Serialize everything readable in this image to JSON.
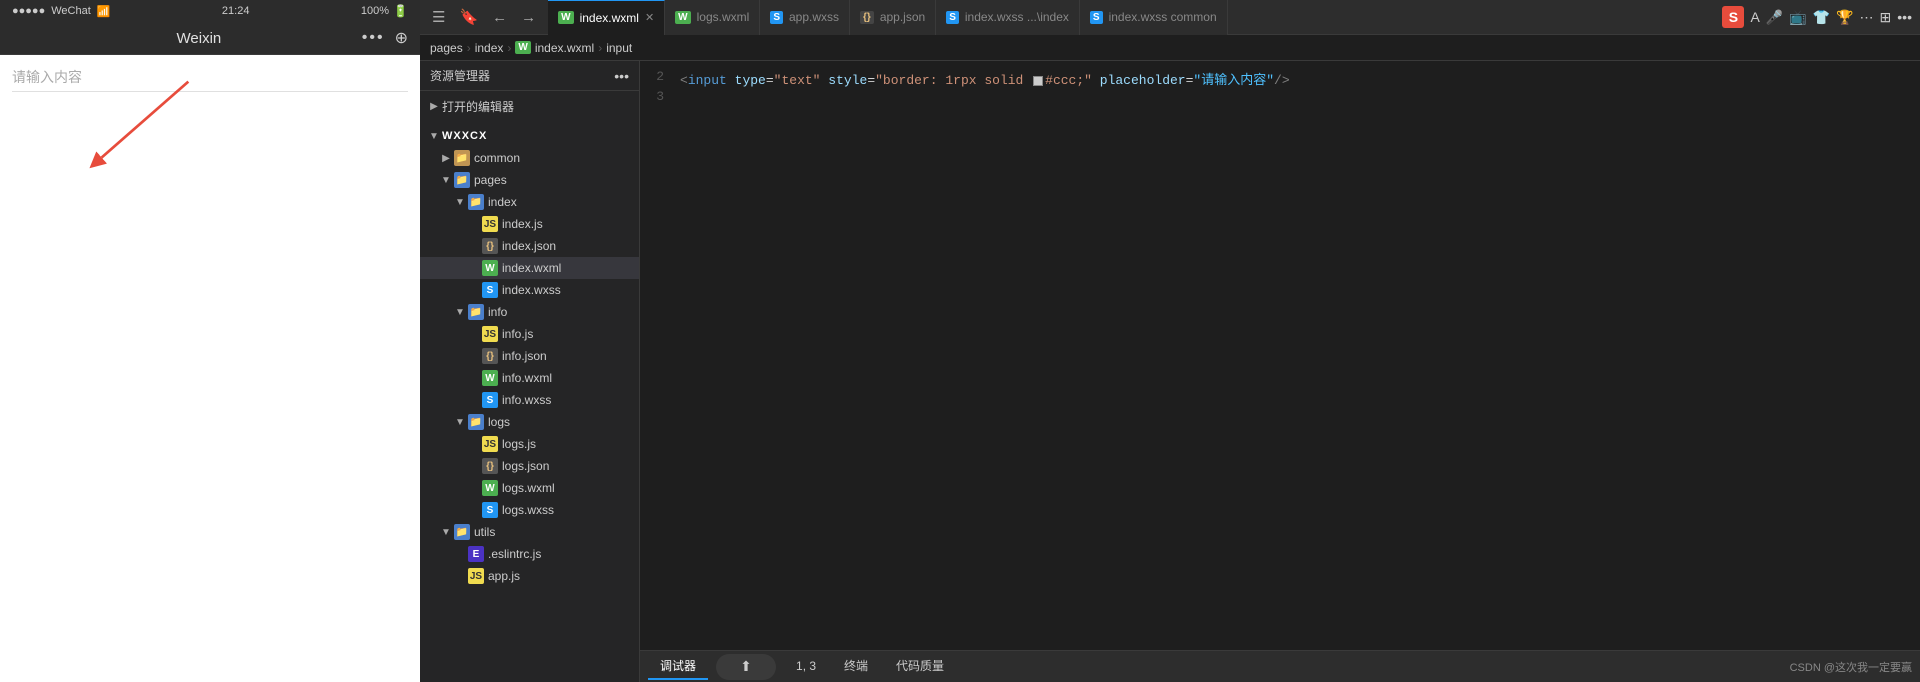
{
  "phone": {
    "status_left": "●●●●● WeChat WiFi",
    "time": "21:24",
    "battery": "100%",
    "title": "Weixin",
    "placeholder": "请输入内容"
  },
  "explorer": {
    "header": "资源管理器",
    "editors_section": "打开的编辑器",
    "root": "WXXCX",
    "tree": [
      {
        "indent": 1,
        "type": "folder",
        "label": "common",
        "expanded": false
      },
      {
        "indent": 1,
        "type": "folder-blue",
        "label": "pages",
        "expanded": true
      },
      {
        "indent": 2,
        "type": "folder-blue",
        "label": "index",
        "expanded": true
      },
      {
        "indent": 3,
        "type": "js",
        "label": "index.js"
      },
      {
        "indent": 3,
        "type": "json",
        "label": "index.json"
      },
      {
        "indent": 3,
        "type": "wxml",
        "label": "index.wxml",
        "active": true
      },
      {
        "indent": 3,
        "type": "wxss",
        "label": "index.wxss"
      },
      {
        "indent": 2,
        "type": "folder-blue",
        "label": "info",
        "expanded": true
      },
      {
        "indent": 3,
        "type": "js",
        "label": "info.js"
      },
      {
        "indent": 3,
        "type": "json",
        "label": "info.json"
      },
      {
        "indent": 3,
        "type": "wxml",
        "label": "info.wxml"
      },
      {
        "indent": 3,
        "type": "wxss",
        "label": "info.wxss"
      },
      {
        "indent": 2,
        "type": "folder-blue",
        "label": "logs",
        "expanded": true
      },
      {
        "indent": 3,
        "type": "js",
        "label": "logs.js"
      },
      {
        "indent": 3,
        "type": "json",
        "label": "logs.json"
      },
      {
        "indent": 3,
        "type": "wxml",
        "label": "logs.wxml"
      },
      {
        "indent": 3,
        "type": "wxss",
        "label": "logs.wxss"
      },
      {
        "indent": 1,
        "type": "folder-blue",
        "label": "utils",
        "expanded": true
      },
      {
        "indent": 2,
        "type": "eslint",
        "label": ".eslintrc.js"
      },
      {
        "indent": 2,
        "type": "js",
        "label": "app.js"
      }
    ]
  },
  "tabs": [
    {
      "label": "index.wxml",
      "type": "wxml",
      "active": true,
      "closeable": true
    },
    {
      "label": "logs.wxml",
      "type": "wxml",
      "active": false,
      "closeable": false
    },
    {
      "label": "app.wxss",
      "type": "wxss",
      "active": false,
      "closeable": false
    },
    {
      "label": "app.json",
      "type": "json",
      "active": false,
      "closeable": false
    },
    {
      "label": "index.wxss ...\\index",
      "type": "wxss",
      "active": false,
      "closeable": false
    },
    {
      "label": "index.wxss  common",
      "type": "wxss",
      "active": false,
      "closeable": false
    }
  ],
  "breadcrumb": {
    "items": [
      "pages",
      "index",
      "index.wxml",
      "input"
    ]
  },
  "code": {
    "line2": "<input type=\"text\" style=\"border: 1rpx solid #ccc;\" placeholder=\"请输入内容\"/>",
    "line2_tokens": [
      {
        "type": "punct",
        "text": "<"
      },
      {
        "type": "tag",
        "text": "input"
      },
      {
        "type": "attr",
        "text": " type"
      },
      {
        "type": "eq",
        "text": "="
      },
      {
        "type": "str",
        "text": "\"text\""
      },
      {
        "type": "attr",
        "text": " style"
      },
      {
        "type": "eq",
        "text": "="
      },
      {
        "type": "str",
        "text": "\"border: 1rpx solid "
      },
      {
        "type": "color-box",
        "color": "#cccccc"
      },
      {
        "type": "str",
        "text": "#ccc;\""
      },
      {
        "type": "attr",
        "text": " placeholder"
      },
      {
        "type": "eq",
        "text": "="
      },
      {
        "type": "str-blue",
        "text": "\"请输入内容\""
      },
      {
        "type": "punct",
        "text": "/>"
      }
    ]
  },
  "bottom_tabs": [
    {
      "label": "调试器",
      "active": true
    },
    {
      "label": "1, 3",
      "active": false
    },
    {
      "label": "终端",
      "active": false
    },
    {
      "label": "代码质量",
      "active": false
    }
  ],
  "right_toolbar": [
    "A",
    "🎤",
    "📺",
    "👕",
    "🏆",
    "⋯"
  ],
  "csdn_badge": "CSDN @这次我一定要赢",
  "header_icons": [
    "☰",
    "🔖",
    "←",
    "→",
    "pages",
    ">",
    "index",
    ">",
    "index.wxml",
    ">",
    "input"
  ]
}
